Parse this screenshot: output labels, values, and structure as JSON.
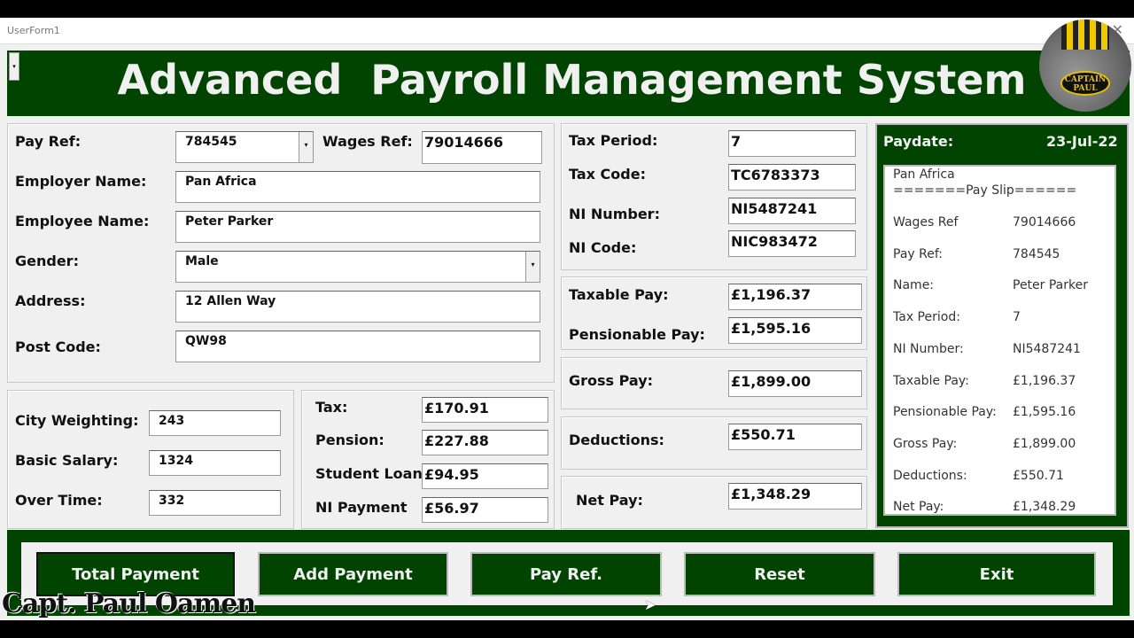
{
  "window": {
    "title": "UserForm1"
  },
  "header": {
    "title": "Advanced  Payroll Management System",
    "logo_text": "CAPTAIN PAUL"
  },
  "employee": {
    "pay_ref_label": "Pay Ref:",
    "pay_ref": "784545",
    "wages_ref_label": "Wages Ref:",
    "wages_ref": "79014666",
    "employer_label": "Employer Name:",
    "employer": "Pan Africa",
    "employee_label": "Employee Name:",
    "employee": "Peter Parker",
    "gender_label": "Gender:",
    "gender": "Male",
    "address_label": "Address:",
    "address": "12 Allen Way",
    "postcode_label": "Post Code:",
    "postcode": "QW98"
  },
  "earnings": {
    "city_label": "City Weighting:",
    "city": "243",
    "basic_label": "Basic Salary:",
    "basic": "1324",
    "overtime_label": "Over Time:",
    "overtime": "332"
  },
  "deductions": {
    "tax_label": "Tax:",
    "tax": "£170.91",
    "pension_label": "Pension:",
    "pension": "£227.88",
    "loan_label": "Student Loan",
    "loan": "£94.95",
    "ni_label": "NI Payment",
    "ni": "£56.97"
  },
  "tax_info": {
    "period_label": "Tax Period:",
    "period": "7",
    "code_label": "Tax Code:",
    "code": "TC6783373",
    "ni_number_label": "NI Number:",
    "ni_number": "NI5487241",
    "ni_code_label": "NI Code:",
    "ni_code": "NIC983472"
  },
  "totals": {
    "taxable_label": "Taxable Pay:",
    "taxable": "£1,196.37",
    "pensionable_label": "Pensionable Pay:",
    "pensionable": "£1,595.16",
    "gross_label": "Gross Pay:",
    "gross": "£1,899.00",
    "deductions_label": "Deductions:",
    "deductions": "£550.71",
    "net_label": "Net Pay:",
    "net": "£1,348.29"
  },
  "payslip": {
    "paydate_label": "Paydate:",
    "paydate": "23-Jul-22",
    "company": "Pan Africa",
    "heading": "=======Pay Slip======",
    "rows": [
      [
        "Wages Ref",
        "79014666"
      ],
      [
        "Pay Ref:",
        "784545"
      ],
      [
        "Name:",
        "Peter Parker"
      ],
      [
        "Tax Period:",
        "7"
      ],
      [
        "NI Number:",
        "NI5487241"
      ],
      [
        "Taxable Pay:",
        "£1,196.37"
      ],
      [
        "Pensionable Pay:",
        "£1,595.16"
      ],
      [
        "Gross Pay:",
        "£1,899.00"
      ],
      [
        "Deductions:",
        "£550.71"
      ],
      [
        "Net Pay:",
        "£1,348.29"
      ]
    ]
  },
  "buttons": {
    "total": "Total  Payment",
    "add": "Add Payment",
    "payref": "Pay Ref.",
    "reset": "Reset",
    "exit": "Exit"
  },
  "watermark": "Capt. Paul Oamen"
}
